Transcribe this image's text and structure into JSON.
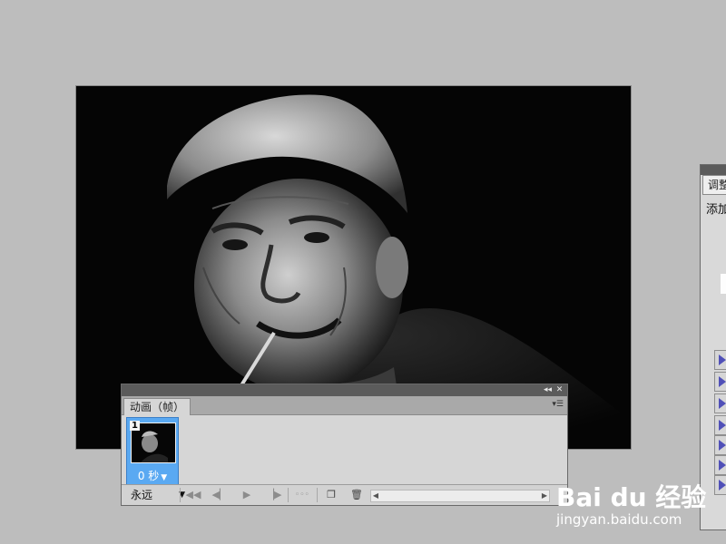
{
  "animation_panel": {
    "tab_label": "动画（帧）",
    "titlebar_collapse_icon": "double-chevron-left-icon",
    "titlebar_close_icon": "close-icon",
    "panel_menu_icon": "panel-menu-icon",
    "frames": [
      {
        "number": "1",
        "delay": "0 秒"
      }
    ],
    "loop_option": "永远",
    "controls": [
      {
        "name": "first-frame-icon"
      },
      {
        "name": "prev-frame-icon"
      },
      {
        "name": "play-icon"
      },
      {
        "name": "next-frame-icon"
      },
      {
        "name": "tween-icon"
      },
      {
        "name": "duplicate-frame-icon"
      },
      {
        "name": "trash-icon"
      }
    ]
  },
  "adjustments_panel": {
    "tab_label": "调整",
    "subtitle": "添加"
  },
  "watermark": {
    "brand": "Bai du 经验",
    "url": "jingyan.baidu.com"
  },
  "colors": {
    "workspace_bg": "#bdbdbd",
    "panel_bg": "#d6d6d6",
    "selected_frame": "#5aa9f2",
    "canvas_bg": "#050505"
  }
}
